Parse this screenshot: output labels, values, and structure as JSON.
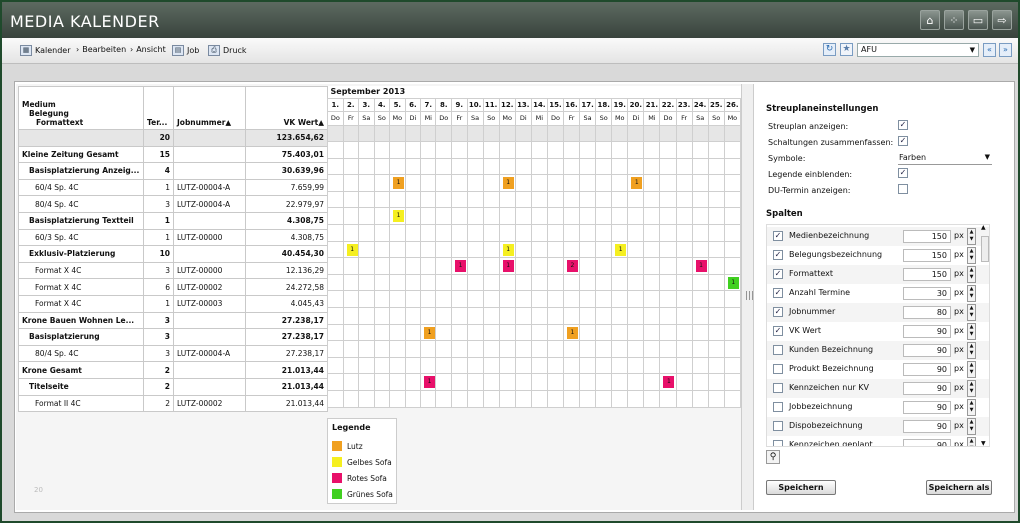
{
  "app": {
    "title": "MEDIA KALENDER"
  },
  "window_icons": [
    "home-icon",
    "grid-icon",
    "speech-icon",
    "exit-icon"
  ],
  "toolbar": {
    "kalender": "Kalender",
    "bearbeiten": "Bearbeiten",
    "ansicht": "Ansicht",
    "job": "Job",
    "druck": "Druck",
    "afu_value": "AFU"
  },
  "grid": {
    "headers": {
      "medium": "Medium",
      "belegung": "Belegung",
      "formattext": "Formattext",
      "termine": "Ter...",
      "jobnummer": "Jobnummer",
      "vkwert": "VK Wert"
    },
    "summary": {
      "termine": "20",
      "vkwert": "123.654,62"
    },
    "rows": [
      {
        "label": "Kleine Zeitung Gesamt",
        "termine": "15",
        "job": "",
        "vk": "75.403,01",
        "level": 0,
        "bold": true
      },
      {
        "label": "Basisplatzierung Anzeig...",
        "termine": "4",
        "job": "",
        "vk": "30.639,96",
        "level": 1,
        "bold": true
      },
      {
        "label": "60/4 Sp. 4C",
        "termine": "1",
        "job": "LUTZ-00004-A",
        "vk": "7.659,99",
        "level": 2,
        "bold": false
      },
      {
        "label": "80/4 Sp. 4C",
        "termine": "3",
        "job": "LUTZ-00004-A",
        "vk": "22.979,97",
        "level": 2,
        "bold": false
      },
      {
        "label": "Basisplatzierung Textteil",
        "termine": "1",
        "job": "",
        "vk": "4.308,75",
        "level": 1,
        "bold": true
      },
      {
        "label": "60/3 Sp. 4C",
        "termine": "1",
        "job": "LUTZ-00000",
        "vk": "4.308,75",
        "level": 2,
        "bold": false
      },
      {
        "label": "Exklusiv-Platzierung",
        "termine": "10",
        "job": "",
        "vk": "40.454,30",
        "level": 1,
        "bold": true
      },
      {
        "label": "Format X 4C",
        "termine": "3",
        "job": "LUTZ-00000",
        "vk": "12.136,29",
        "level": 2,
        "bold": false
      },
      {
        "label": "Format X 4C",
        "termine": "6",
        "job": "LUTZ-00002",
        "vk": "24.272,58",
        "level": 2,
        "bold": false
      },
      {
        "label": "Format X 4C",
        "termine": "1",
        "job": "LUTZ-00003",
        "vk": "4.045,43",
        "level": 2,
        "bold": false
      },
      {
        "label": "Krone Bauen Wohnen Le...",
        "termine": "3",
        "job": "",
        "vk": "27.238,17",
        "level": 0,
        "bold": true
      },
      {
        "label": "Basisplatzierung",
        "termine": "3",
        "job": "",
        "vk": "27.238,17",
        "level": 1,
        "bold": true
      },
      {
        "label": "80/4 Sp. 4C",
        "termine": "3",
        "job": "LUTZ-00004-A",
        "vk": "27.238,17",
        "level": 2,
        "bold": false
      },
      {
        "label": "Krone Gesamt",
        "termine": "2",
        "job": "",
        "vk": "21.013,44",
        "level": 0,
        "bold": true
      },
      {
        "label": "Titelseite",
        "termine": "2",
        "job": "",
        "vk": "21.013,44",
        "level": 1,
        "bold": true
      },
      {
        "label": "Format II 4C",
        "termine": "2",
        "job": "LUTZ-00002",
        "vk": "21.013,44",
        "level": 2,
        "bold": false
      }
    ]
  },
  "calendar": {
    "month": "September 2013",
    "days": [
      "1.",
      "2.",
      "3.",
      "4.",
      "5.",
      "6.",
      "7.",
      "8.",
      "9.",
      "10.",
      "11.",
      "12.",
      "13.",
      "14.",
      "15.",
      "16.",
      "17.",
      "18.",
      "19.",
      "20.",
      "21.",
      "22.",
      "23.",
      "24.",
      "25.",
      "26."
    ],
    "weekdays": [
      "Do",
      "Fr",
      "Sa",
      "So",
      "Mo",
      "Di",
      "Mi",
      "Do",
      "Fr",
      "Sa",
      "So",
      "Mo",
      "Di",
      "Mi",
      "Do",
      "Fr",
      "Sa",
      "So",
      "Mo",
      "Di",
      "Mi",
      "Do",
      "Fr",
      "Sa",
      "So",
      "Mo"
    ],
    "marks": [
      {
        "row": 3,
        "day": 4,
        "value": "1",
        "color": "#f0a020"
      },
      {
        "row": 3,
        "day": 11,
        "value": "1",
        "color": "#f0a020"
      },
      {
        "row": 3,
        "day": 19,
        "value": "1",
        "color": "#f0a020"
      },
      {
        "row": 5,
        "day": 4,
        "value": "1",
        "color": "#f5ef20"
      },
      {
        "row": 7,
        "day": 1,
        "value": "1",
        "color": "#f5ef20"
      },
      {
        "row": 7,
        "day": 11,
        "value": "1",
        "color": "#f5ef20"
      },
      {
        "row": 7,
        "day": 18,
        "value": "1",
        "color": "#f5ef20"
      },
      {
        "row": 8,
        "day": 8,
        "value": "1",
        "color": "#e8106a"
      },
      {
        "row": 8,
        "day": 11,
        "value": "1",
        "color": "#e8106a"
      },
      {
        "row": 8,
        "day": 15,
        "value": "2",
        "color": "#e8106a"
      },
      {
        "row": 8,
        "day": 23,
        "value": "1",
        "color": "#e8106a"
      },
      {
        "row": 9,
        "day": 25,
        "value": "1",
        "color": "#40d020"
      },
      {
        "row": 12,
        "day": 6,
        "value": "1",
        "color": "#f0a020"
      },
      {
        "row": 12,
        "day": 15,
        "value": "1",
        "color": "#f0a020"
      },
      {
        "row": 15,
        "day": 6,
        "value": "1",
        "color": "#e8106a"
      },
      {
        "row": 15,
        "day": 21,
        "value": "1",
        "color": "#e8106a"
      }
    ]
  },
  "legend": {
    "title": "Legende",
    "items": [
      {
        "label": "Lutz",
        "color": "#f0a020"
      },
      {
        "label": "Gelbes Sofa",
        "color": "#f5ef20"
      },
      {
        "label": "Rotes Sofa",
        "color": "#e8106a"
      },
      {
        "label": "Grünes Sofa",
        "color": "#40d020"
      }
    ]
  },
  "settings": {
    "title": "Streuplaneinstellungen",
    "streuplan": "Streuplan anzeigen:",
    "schaltungen": "Schaltungen zusammenfassen:",
    "symbole": "Symbole:",
    "symbole_value": "Farben",
    "legende": "Legende einblenden:",
    "du_termin": "DU-Termin anzeigen:",
    "spalten_title": "Spalten",
    "columns": [
      {
        "name": "Medienbezeichnung",
        "px": "150",
        "checked": true
      },
      {
        "name": "Belegungsbezeichnung",
        "px": "150",
        "checked": true
      },
      {
        "name": "Formattext",
        "px": "150",
        "checked": true
      },
      {
        "name": "Anzahl Termine",
        "px": "30",
        "checked": true
      },
      {
        "name": "Jobnummer",
        "px": "80",
        "checked": true
      },
      {
        "name": "VK Wert",
        "px": "90",
        "checked": true
      },
      {
        "name": "Kunden Bezeichnung",
        "px": "90",
        "checked": false
      },
      {
        "name": "Produkt Bezeichnung",
        "px": "90",
        "checked": false
      },
      {
        "name": "Kennzeichen nur KV",
        "px": "90",
        "checked": false
      },
      {
        "name": "Jobbezeichnung",
        "px": "90",
        "checked": false
      },
      {
        "name": "Dispobezeichnung",
        "px": "90",
        "checked": false
      },
      {
        "name": "Kennzeichen geplant",
        "px": "90",
        "checked": false
      }
    ],
    "px_unit": "px",
    "save": "Speichern",
    "save_as": "Speichern als"
  },
  "footer": {
    "page_no": "20"
  }
}
